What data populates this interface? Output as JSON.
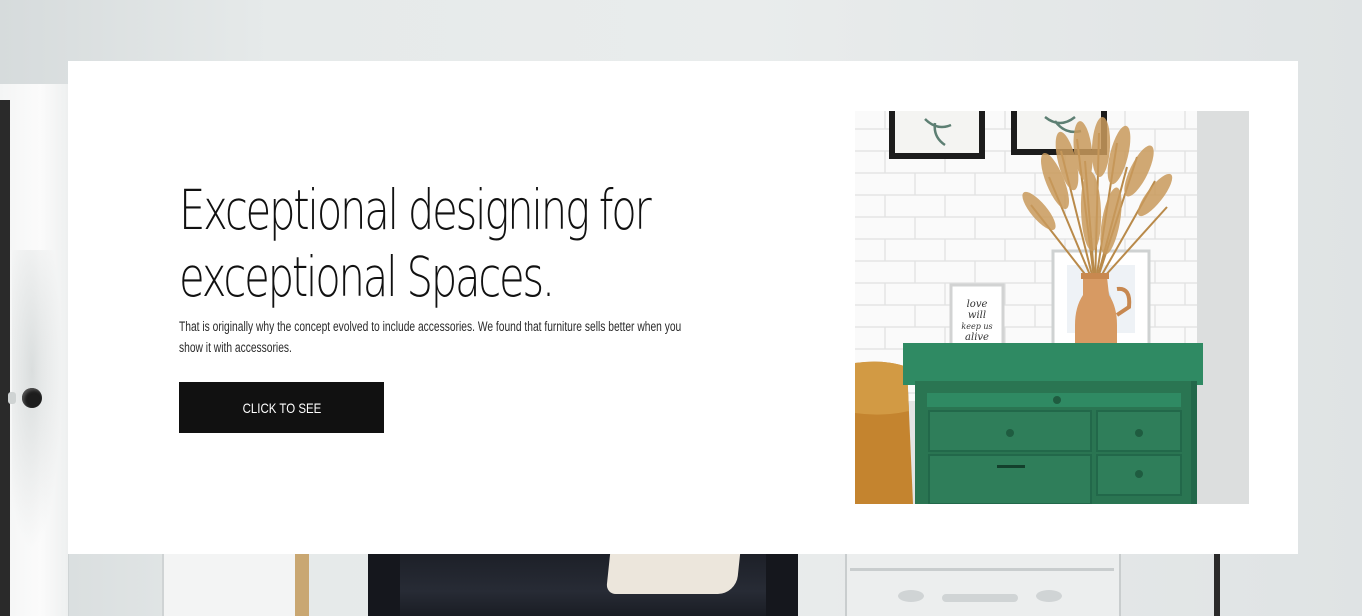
{
  "hero": {
    "headline_line1": "Exceptional designing for",
    "headline_line2": "exceptional Spaces.",
    "description": "That is originally why the concept evolved to include accessories. We found that furniture sells better when you show it with accessories.",
    "cta_label": "CLICK TO SEE"
  },
  "photo": {
    "frame_text": [
      "love",
      "will",
      "keep us",
      "alive"
    ]
  },
  "colors": {
    "card_bg": "#ffffff",
    "button_bg": "#111111",
    "button_text": "#ffffff",
    "text": "#111111",
    "dresser": "#2d7a5a"
  }
}
